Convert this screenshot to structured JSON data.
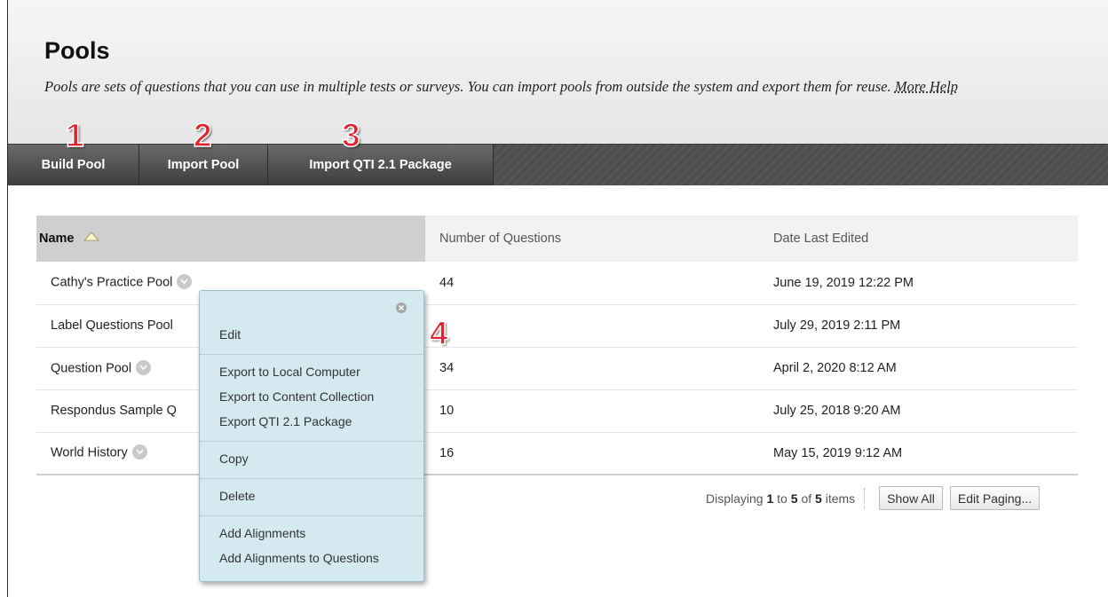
{
  "page": {
    "title": "Pools",
    "description": "Pools are sets of questions that you can use in multiple tests or surveys. You can import pools from outside the system and export them for reuse.",
    "more_help": "More Help"
  },
  "actionbar": {
    "build_pool": "Build Pool",
    "import_pool": "Import Pool",
    "import_qti": "Import QTI 2.1 Package"
  },
  "markers": [
    "1",
    "2",
    "3",
    "4"
  ],
  "table": {
    "headers": {
      "name": "Name",
      "questions": "Number of Questions",
      "date": "Date Last Edited"
    },
    "sort": {
      "column": "Name",
      "direction": "ascending",
      "icon": "triangle-up-icon"
    },
    "rows": [
      {
        "name": "Cathy's Practice Pool",
        "questions": "44",
        "date": "June 19, 2019 12:22 PM"
      },
      {
        "name": "Label Questions Pool",
        "questions": "",
        "date": "July 29, 2019 2:11 PM"
      },
      {
        "name": "Question Pool",
        "questions": "34",
        "date": "April 2, 2020 8:12 AM"
      },
      {
        "name": "Respondus Sample Q",
        "questions": "10",
        "date": "July 25, 2018 9:20 AM"
      },
      {
        "name": "World History",
        "questions": "16",
        "date": "May 15, 2019 9:12 AM"
      }
    ]
  },
  "pagination": {
    "prefix": "Displaying",
    "start": "1",
    "to": "to",
    "end": "5",
    "of": "of",
    "total": "5",
    "suffix": "items",
    "show_all": "Show All",
    "edit_paging": "Edit Paging..."
  },
  "context_menu": {
    "close_icon": "close-icon",
    "groups": [
      [
        "Edit"
      ],
      [
        "Export to Local Computer",
        "Export to Content Collection",
        "Export QTI 2.1 Package"
      ],
      [
        "Copy"
      ],
      [
        "Delete"
      ],
      [
        "Add Alignments",
        "Add Alignments to Questions"
      ]
    ]
  },
  "colors": {
    "marker": "#e0232e",
    "menu_background": "#d4eaf0",
    "actionbar": "#4e4e4e"
  }
}
